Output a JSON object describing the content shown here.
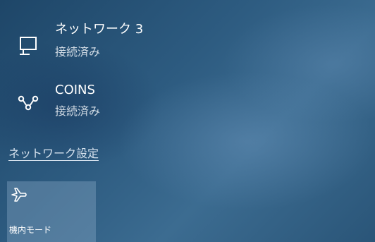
{
  "networks": [
    {
      "icon": "wired-network-icon",
      "name": "ネットワーク 3",
      "status": "接続済み"
    },
    {
      "icon": "dialup-network-icon",
      "name": "COINS",
      "status": "接続済み"
    }
  ],
  "settings_link": "ネットワーク設定",
  "quick_actions": [
    {
      "icon": "airplane-icon",
      "label": "機内モード",
      "state": "off"
    }
  ]
}
